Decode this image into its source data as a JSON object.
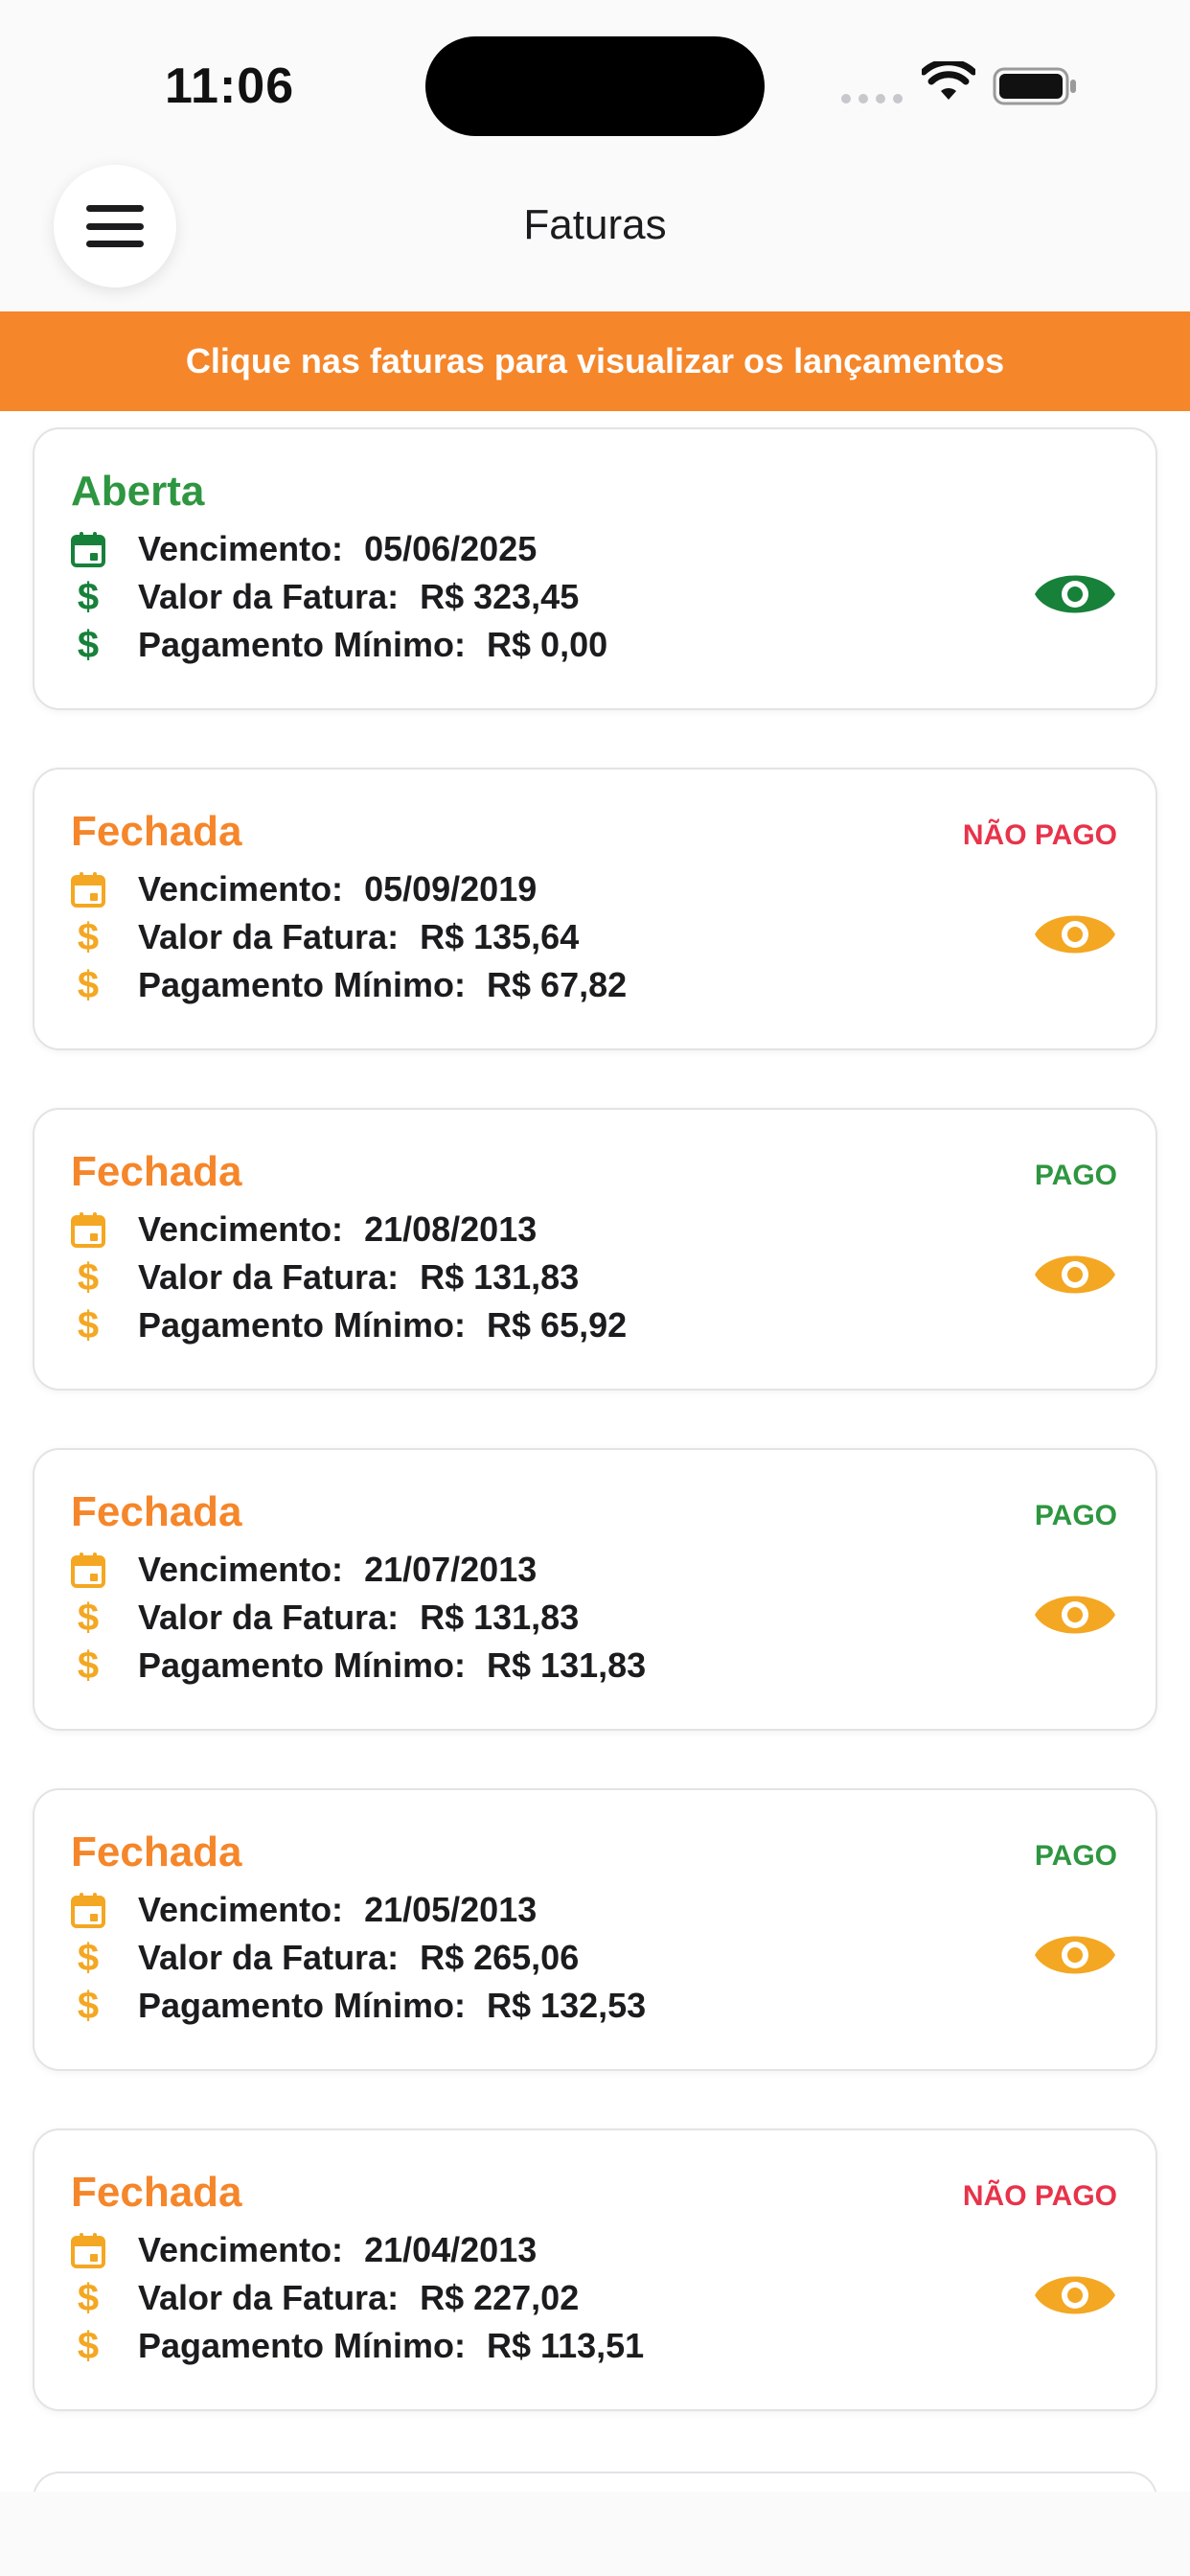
{
  "status_bar": {
    "time": "11:06",
    "icons": [
      "signal-dots-icon",
      "wifi-icon",
      "battery-icon"
    ]
  },
  "header": {
    "title": "Faturas",
    "menu_icon": "hamburger-menu-icon"
  },
  "banner": {
    "text": "Clique nas faturas para visualizar os lançamentos",
    "color": "#f5862a"
  },
  "labels": {
    "due_date": "Vencimento:",
    "invoice_value": "Valor da Fatura:",
    "minimum_payment": "Pagamento Mínimo:"
  },
  "colors": {
    "open": "#2e9640",
    "open_icon": "#17813a",
    "closed": "#f5862a",
    "closed_icon": "#f4a722",
    "paid": "#2e9640",
    "unpaid": "#e8334a"
  },
  "invoices": [
    {
      "status": "Aberta",
      "state": "open",
      "badge": "",
      "due_date": "05/06/2025",
      "value": "R$ 323,45",
      "minimum": "R$ 0,00"
    },
    {
      "status": "Fechada",
      "state": "closed",
      "badge": "NÃO PAGO",
      "badge_state": "unpaid",
      "due_date": "05/09/2019",
      "value": "R$ 135,64",
      "minimum": "R$ 67,82"
    },
    {
      "status": "Fechada",
      "state": "closed",
      "badge": "PAGO",
      "badge_state": "paid",
      "due_date": "21/08/2013",
      "value": "R$ 131,83",
      "minimum": "R$ 65,92"
    },
    {
      "status": "Fechada",
      "state": "closed",
      "badge": "PAGO",
      "badge_state": "paid",
      "due_date": "21/07/2013",
      "value": "R$ 131,83",
      "minimum": "R$ 131,83"
    },
    {
      "status": "Fechada",
      "state": "closed",
      "badge": "PAGO",
      "badge_state": "paid",
      "due_date": "21/05/2013",
      "value": "R$ 265,06",
      "minimum": "R$ 132,53"
    },
    {
      "status": "Fechada",
      "state": "closed",
      "badge": "NÃO PAGO",
      "badge_state": "unpaid",
      "due_date": "21/04/2013",
      "value": "R$ 227,02",
      "minimum": "R$ 113,51"
    }
  ]
}
